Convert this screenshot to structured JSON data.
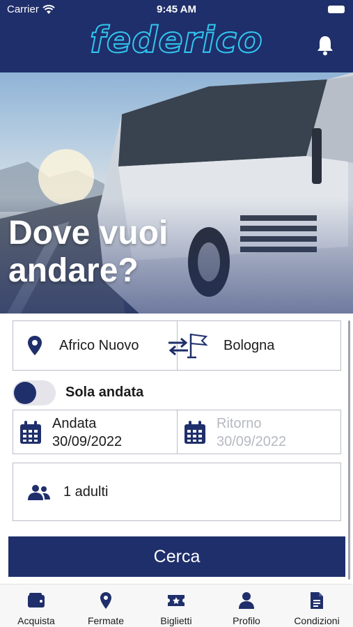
{
  "status_bar": {
    "carrier": "Carrier",
    "time": "9:45 AM"
  },
  "header": {
    "logo_text": "federico",
    "bell_icon": "bell-icon"
  },
  "hero": {
    "headline": "Dove vuoi andare?"
  },
  "route": {
    "from": "Africo Nuovo",
    "to": "Bologna"
  },
  "trip_type": {
    "label": "Sola andata",
    "enabled": true
  },
  "dates": {
    "outbound_label": "Andata",
    "outbound_value": "30/09/2022",
    "return_label": "Ritorno",
    "return_value": "30/09/2022"
  },
  "passengers": {
    "label": "1 adulti"
  },
  "search_button": {
    "label": "Cerca"
  },
  "colors": {
    "primary": "#1f2f6b",
    "logo": "#31c8f0",
    "disabled_text": "#b6b9c2"
  },
  "tabs": [
    {
      "label": "Acquista",
      "icon": "wallet-icon"
    },
    {
      "label": "Fermate",
      "icon": "map-pin-icon"
    },
    {
      "label": "Biglietti",
      "icon": "ticket-icon"
    },
    {
      "label": "Profilo",
      "icon": "user-icon"
    },
    {
      "label": "Condizioni",
      "icon": "document-icon"
    }
  ]
}
